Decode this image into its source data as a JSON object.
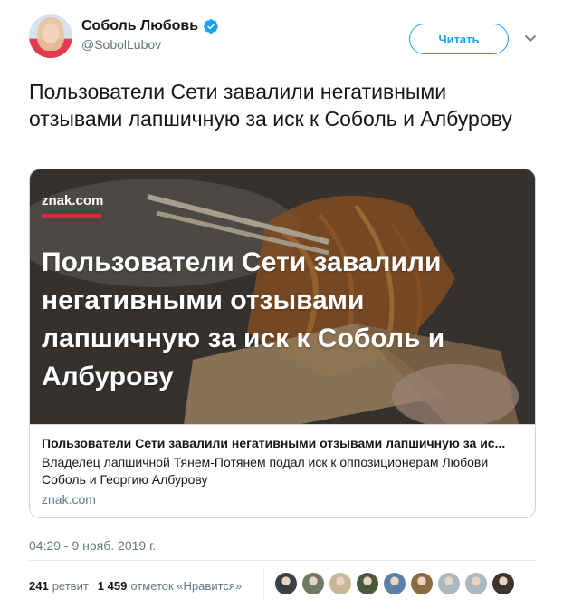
{
  "author": {
    "display_name": "Соболь Любовь",
    "handle": "@SobolLubov",
    "verified_icon": "verified-badge-icon",
    "avatar_icon": "avatar-photo"
  },
  "actions": {
    "follow_label": "Читать",
    "menu_icon": "chevron-down-icon"
  },
  "tweet": {
    "text": "Пользователи Сети завалили негативными отзывами лапшичную за иск к Соболь и Албурову",
    "timestamp": "04:29 - 9 нояб. 2019 г."
  },
  "card": {
    "brand": "znak.com",
    "image_headline": "Пользователи Сети завалили негативными отзывами лапшичную за иск к Соболь и Албурову",
    "title": "Пользователи Сети завалили негативными отзывами лапшичную за ис...",
    "description": "Владелец лапшичной Тянем-Потянем подал иск к оппозиционерам Любови Соболь и Георгию Албурову",
    "domain": "znak.com",
    "brand_bar_color": "#e0263d"
  },
  "stats": {
    "retweets_count": "241",
    "retweets_label": "ретвит",
    "likes_count": "1 459",
    "likes_label": "отметок «Нравится»"
  },
  "likers": [
    {
      "name": "liker-avatar-1",
      "color": "#3a3f44"
    },
    {
      "name": "liker-avatar-2",
      "color": "#6f7a63"
    },
    {
      "name": "liker-avatar-3",
      "color": "#c9b79a"
    },
    {
      "name": "liker-avatar-4",
      "color": "#4a5a3c"
    },
    {
      "name": "liker-avatar-5",
      "color": "#5b7fa6"
    },
    {
      "name": "liker-avatar-6",
      "color": "#8a6a3e"
    },
    {
      "name": "liker-avatar-7",
      "color": "#aab8c2"
    },
    {
      "name": "liker-avatar-8",
      "color": "#aab8c2"
    },
    {
      "name": "liker-avatar-9",
      "color": "#3d342c"
    }
  ],
  "colors": {
    "accent": "#1da1f2",
    "text_secondary": "#657786",
    "border": "#ccd6dd"
  }
}
